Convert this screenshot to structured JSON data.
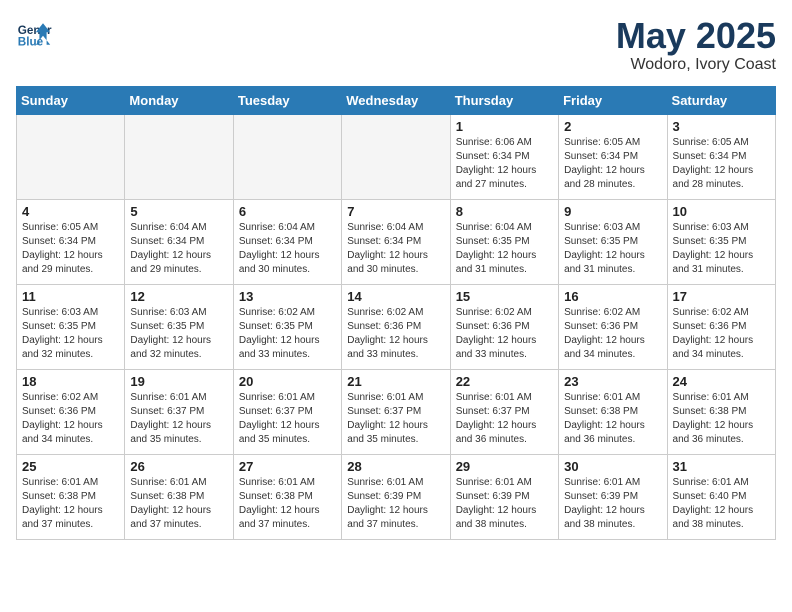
{
  "header": {
    "logo_line1": "General",
    "logo_line2": "Blue",
    "month_year": "May 2025",
    "location": "Wodoro, Ivory Coast"
  },
  "days_of_week": [
    "Sunday",
    "Monday",
    "Tuesday",
    "Wednesday",
    "Thursday",
    "Friday",
    "Saturday"
  ],
  "weeks": [
    [
      {
        "day": "",
        "info": ""
      },
      {
        "day": "",
        "info": ""
      },
      {
        "day": "",
        "info": ""
      },
      {
        "day": "",
        "info": ""
      },
      {
        "day": "1",
        "info": "Sunrise: 6:06 AM\nSunset: 6:34 PM\nDaylight: 12 hours and 27 minutes."
      },
      {
        "day": "2",
        "info": "Sunrise: 6:05 AM\nSunset: 6:34 PM\nDaylight: 12 hours and 28 minutes."
      },
      {
        "day": "3",
        "info": "Sunrise: 6:05 AM\nSunset: 6:34 PM\nDaylight: 12 hours and 28 minutes."
      }
    ],
    [
      {
        "day": "4",
        "info": "Sunrise: 6:05 AM\nSunset: 6:34 PM\nDaylight: 12 hours and 29 minutes."
      },
      {
        "day": "5",
        "info": "Sunrise: 6:04 AM\nSunset: 6:34 PM\nDaylight: 12 hours and 29 minutes."
      },
      {
        "day": "6",
        "info": "Sunrise: 6:04 AM\nSunset: 6:34 PM\nDaylight: 12 hours and 30 minutes."
      },
      {
        "day": "7",
        "info": "Sunrise: 6:04 AM\nSunset: 6:34 PM\nDaylight: 12 hours and 30 minutes."
      },
      {
        "day": "8",
        "info": "Sunrise: 6:04 AM\nSunset: 6:35 PM\nDaylight: 12 hours and 31 minutes."
      },
      {
        "day": "9",
        "info": "Sunrise: 6:03 AM\nSunset: 6:35 PM\nDaylight: 12 hours and 31 minutes."
      },
      {
        "day": "10",
        "info": "Sunrise: 6:03 AM\nSunset: 6:35 PM\nDaylight: 12 hours and 31 minutes."
      }
    ],
    [
      {
        "day": "11",
        "info": "Sunrise: 6:03 AM\nSunset: 6:35 PM\nDaylight: 12 hours and 32 minutes."
      },
      {
        "day": "12",
        "info": "Sunrise: 6:03 AM\nSunset: 6:35 PM\nDaylight: 12 hours and 32 minutes."
      },
      {
        "day": "13",
        "info": "Sunrise: 6:02 AM\nSunset: 6:35 PM\nDaylight: 12 hours and 33 minutes."
      },
      {
        "day": "14",
        "info": "Sunrise: 6:02 AM\nSunset: 6:36 PM\nDaylight: 12 hours and 33 minutes."
      },
      {
        "day": "15",
        "info": "Sunrise: 6:02 AM\nSunset: 6:36 PM\nDaylight: 12 hours and 33 minutes."
      },
      {
        "day": "16",
        "info": "Sunrise: 6:02 AM\nSunset: 6:36 PM\nDaylight: 12 hours and 34 minutes."
      },
      {
        "day": "17",
        "info": "Sunrise: 6:02 AM\nSunset: 6:36 PM\nDaylight: 12 hours and 34 minutes."
      }
    ],
    [
      {
        "day": "18",
        "info": "Sunrise: 6:02 AM\nSunset: 6:36 PM\nDaylight: 12 hours and 34 minutes."
      },
      {
        "day": "19",
        "info": "Sunrise: 6:01 AM\nSunset: 6:37 PM\nDaylight: 12 hours and 35 minutes."
      },
      {
        "day": "20",
        "info": "Sunrise: 6:01 AM\nSunset: 6:37 PM\nDaylight: 12 hours and 35 minutes."
      },
      {
        "day": "21",
        "info": "Sunrise: 6:01 AM\nSunset: 6:37 PM\nDaylight: 12 hours and 35 minutes."
      },
      {
        "day": "22",
        "info": "Sunrise: 6:01 AM\nSunset: 6:37 PM\nDaylight: 12 hours and 36 minutes."
      },
      {
        "day": "23",
        "info": "Sunrise: 6:01 AM\nSunset: 6:38 PM\nDaylight: 12 hours and 36 minutes."
      },
      {
        "day": "24",
        "info": "Sunrise: 6:01 AM\nSunset: 6:38 PM\nDaylight: 12 hours and 36 minutes."
      }
    ],
    [
      {
        "day": "25",
        "info": "Sunrise: 6:01 AM\nSunset: 6:38 PM\nDaylight: 12 hours and 37 minutes."
      },
      {
        "day": "26",
        "info": "Sunrise: 6:01 AM\nSunset: 6:38 PM\nDaylight: 12 hours and 37 minutes."
      },
      {
        "day": "27",
        "info": "Sunrise: 6:01 AM\nSunset: 6:38 PM\nDaylight: 12 hours and 37 minutes."
      },
      {
        "day": "28",
        "info": "Sunrise: 6:01 AM\nSunset: 6:39 PM\nDaylight: 12 hours and 37 minutes."
      },
      {
        "day": "29",
        "info": "Sunrise: 6:01 AM\nSunset: 6:39 PM\nDaylight: 12 hours and 38 minutes."
      },
      {
        "day": "30",
        "info": "Sunrise: 6:01 AM\nSunset: 6:39 PM\nDaylight: 12 hours and 38 minutes."
      },
      {
        "day": "31",
        "info": "Sunrise: 6:01 AM\nSunset: 6:40 PM\nDaylight: 12 hours and 38 minutes."
      }
    ]
  ]
}
